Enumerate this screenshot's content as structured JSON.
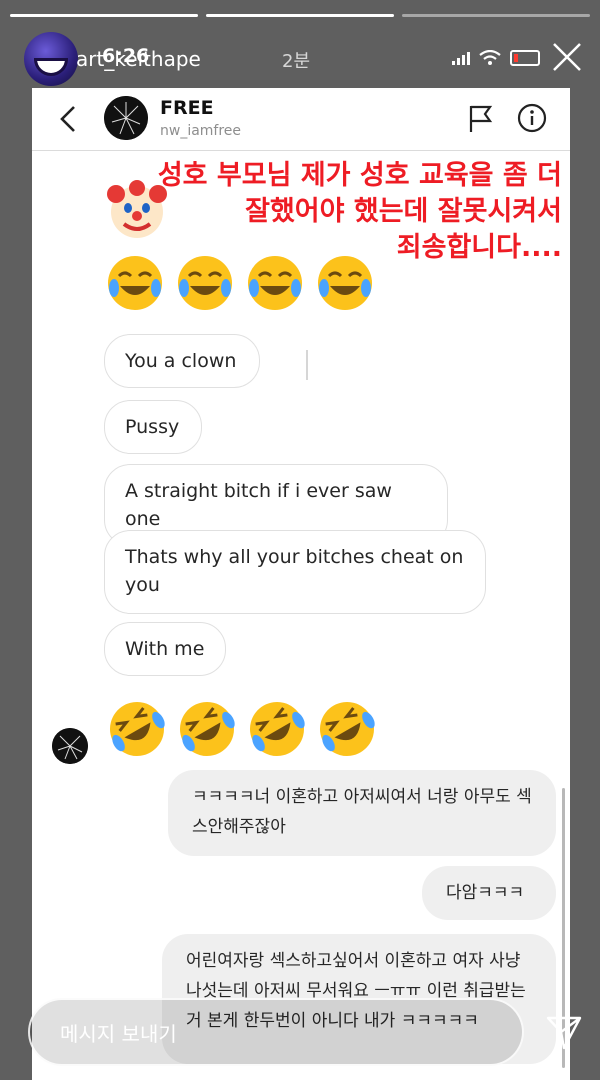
{
  "story": {
    "username": "art_keithape",
    "time": "6:26",
    "ago": "2분",
    "progress_segments": [
      1,
      1,
      0
    ]
  },
  "dm": {
    "name": "FREE",
    "handle": "nw_iamfree"
  },
  "overlay_text": "성호 부모님 제가 성호 교육을 좀 더\n잘했어야 했는데 잘못시켜서\n죄송합니다....",
  "messages_left": [
    "You a clown",
    "Pussy",
    "A straight bitch if i ever saw one",
    "Thats why all your bitches cheat on you",
    "With me"
  ],
  "messages_right": [
    "ㅋㅋㅋㅋ너 이혼하고 아저씨여서 너랑 아무도 섹스안해주잖아",
    "다암ㅋㅋㅋ",
    "어린여자랑 섹스하고싶어서 이혼하고 여자 사냥 나섯는데 아저씨 무서워요 ㅡㅠㅠ 이런 취급받는거 본게 한두번이 아니다 내가 ㅋㅋㅋㅋㅋ"
  ],
  "emoji_rows": {
    "row1": [
      "tears-of-joy",
      "tears-of-joy",
      "tears-of-joy",
      "tears-of-joy"
    ],
    "row2": [
      "rolling-laughing",
      "rolling-laughing",
      "rolling-laughing",
      "rolling-laughing"
    ]
  },
  "reply": {
    "placeholder": "메시지 보내기"
  },
  "colors": {
    "overlay_red": "#ee1c24",
    "bubble_gray": "#efefef"
  }
}
